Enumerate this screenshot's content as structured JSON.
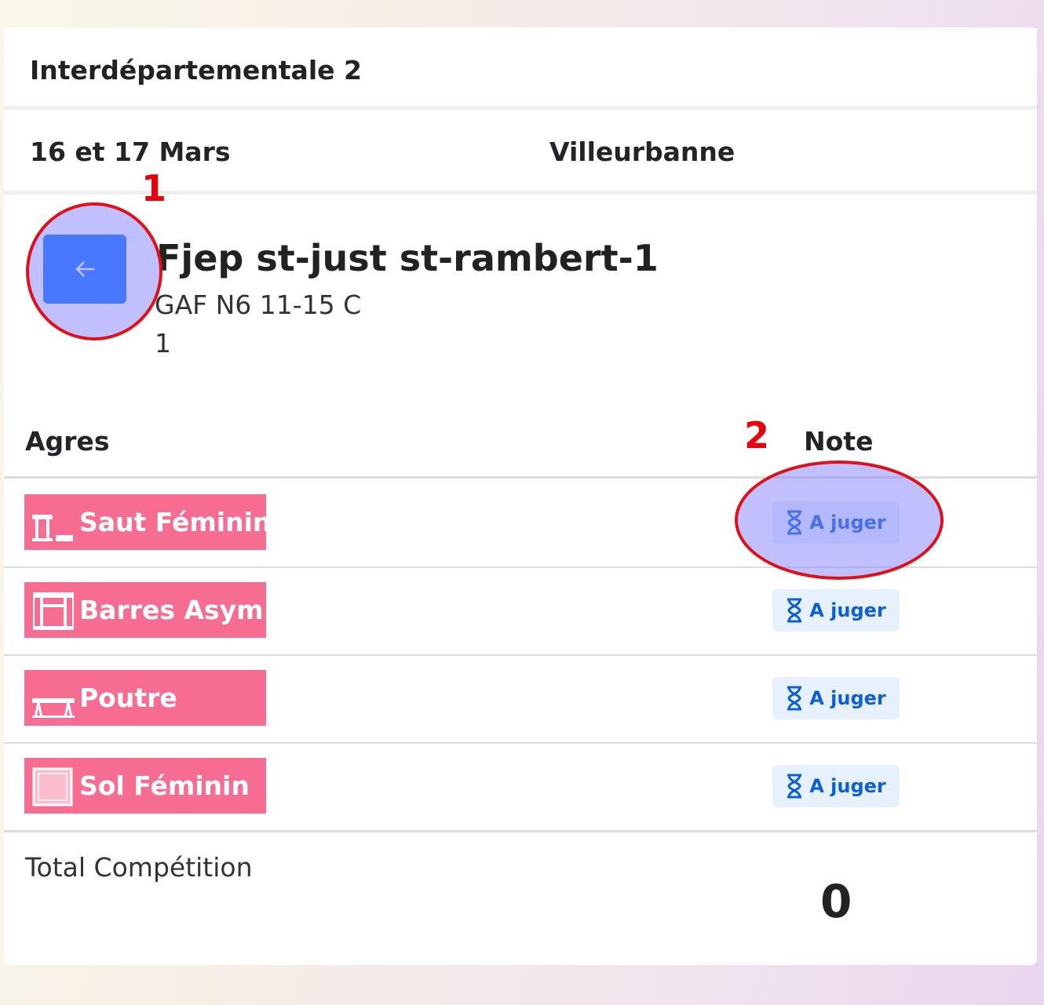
{
  "competition": {
    "name": "Interdépartementale 2",
    "date": "16 et 17 Mars",
    "location": "Villeurbanne"
  },
  "team": {
    "name": "Fjep st-just st-rambert-1",
    "category": "GAF N6 11-15 C",
    "number": "1"
  },
  "table": {
    "header_agres": "Agres",
    "header_note": "Note",
    "rows": [
      {
        "apparatus": "Saut Féminin",
        "icon": "vault-icon",
        "status": "A juger"
      },
      {
        "apparatus": "Barres Asym.",
        "icon": "uneven-bars-icon",
        "status": "A juger"
      },
      {
        "apparatus": "Poutre",
        "icon": "beam-icon",
        "status": "A juger"
      },
      {
        "apparatus": "Sol Féminin",
        "icon": "floor-icon",
        "status": "A juger"
      }
    ]
  },
  "total": {
    "label": "Total Compétition",
    "value": "0"
  },
  "annotations": [
    "1",
    "2"
  ],
  "colors": {
    "primary": "#0d6efd",
    "apparatus_badge": "#f76d92",
    "status_bg": "#e7f1fd",
    "status_text": "#0d5fd8",
    "annotation": "#e8000d"
  }
}
